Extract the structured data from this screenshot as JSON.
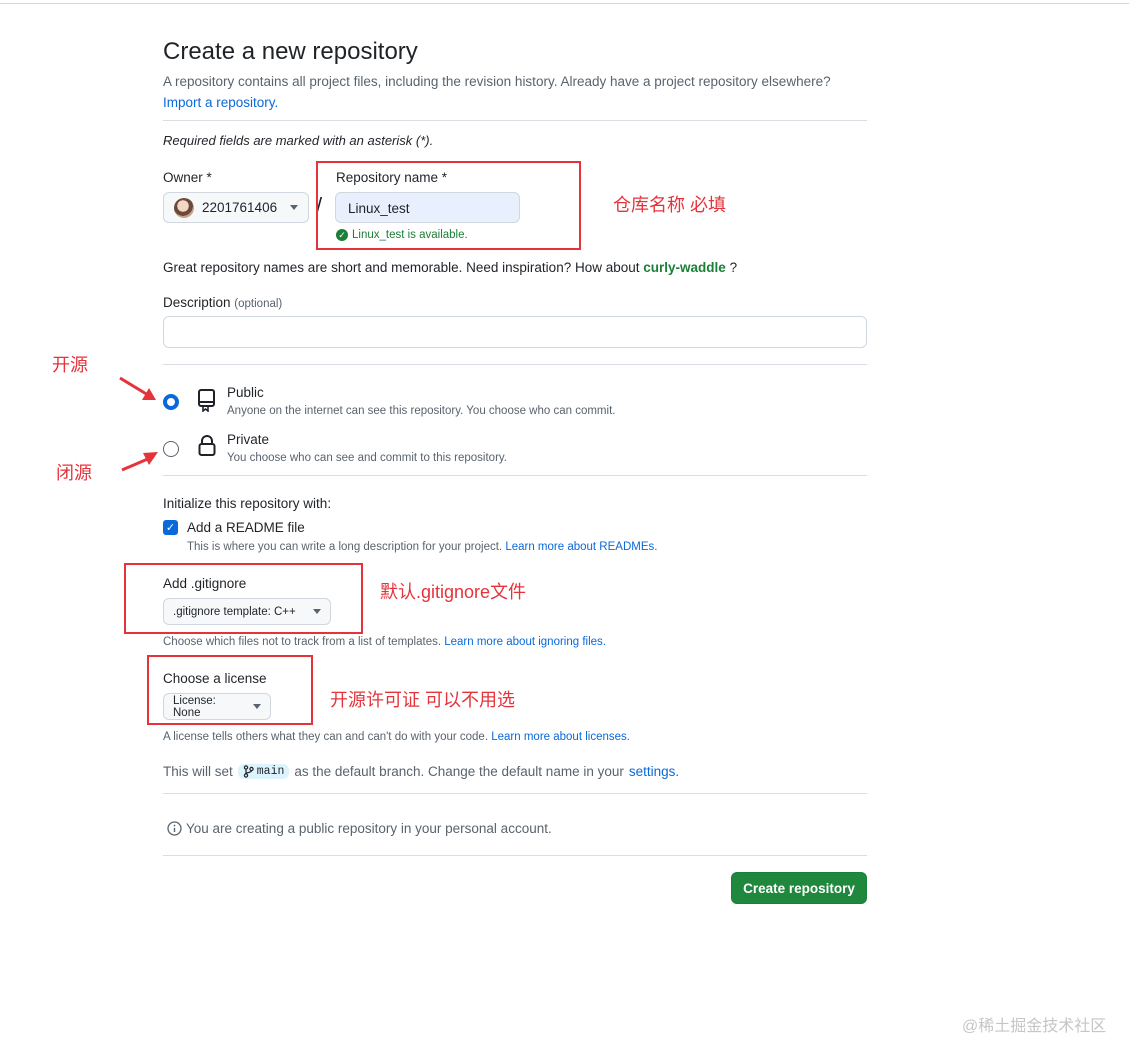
{
  "page": {
    "title": "Create a new repository",
    "subtitle": "A repository contains all project files, including the revision history. Already have a project repository elsewhere?",
    "import_link": "Import a repository.",
    "required_note": "Required fields are marked with an asterisk (*)."
  },
  "owner": {
    "label": "Owner *",
    "value": "2201761406"
  },
  "separator": "/",
  "repo_name": {
    "label": "Repository name *",
    "value": "Linux_test",
    "available_msg": "Linux_test is available."
  },
  "suggestion": {
    "text": "Great repository names are short and memorable. Need inspiration? How about",
    "name": "curly-waddle",
    "suffix": "?"
  },
  "description": {
    "label": "Description",
    "optional": "(optional)",
    "value": ""
  },
  "visibility": {
    "public": {
      "label": "Public",
      "desc": "Anyone on the internet can see this repository. You choose who can commit.",
      "selected": true
    },
    "private": {
      "label": "Private",
      "desc": "You choose who can see and commit to this repository.",
      "selected": false
    }
  },
  "init": {
    "heading": "Initialize this repository with:",
    "readme_label": "Add a README file",
    "readme_checked": true,
    "readme_desc": "This is where you can write a long description for your project.",
    "readme_link": "Learn more about READMEs."
  },
  "gitignore": {
    "label": "Add .gitignore",
    "select": ".gitignore template: C++",
    "desc": "Choose which files not to track from a list of templates.",
    "link": "Learn more about ignoring files."
  },
  "license": {
    "label": "Choose a license",
    "select": "License: None",
    "desc": "A license tells others what they can and can't do with your code.",
    "link": "Learn more about licenses."
  },
  "branch": {
    "prefix": "This will set",
    "name": "main",
    "middle": "as the default branch. Change the default name in your",
    "link": "settings."
  },
  "notice": "You are creating a public repository in your personal account.",
  "create_button": "Create repository",
  "annotations": {
    "repo_name": "仓库名称 必填",
    "open_source": "开源",
    "closed_source": "闭源",
    "gitignore": "默认.gitignore文件",
    "license": "开源许可证 可以不用选"
  },
  "watermark": "@稀土掘金技术社区",
  "colors": {
    "accent": "#0969da",
    "success": "#1f883d",
    "annotation": "#e5333b"
  }
}
